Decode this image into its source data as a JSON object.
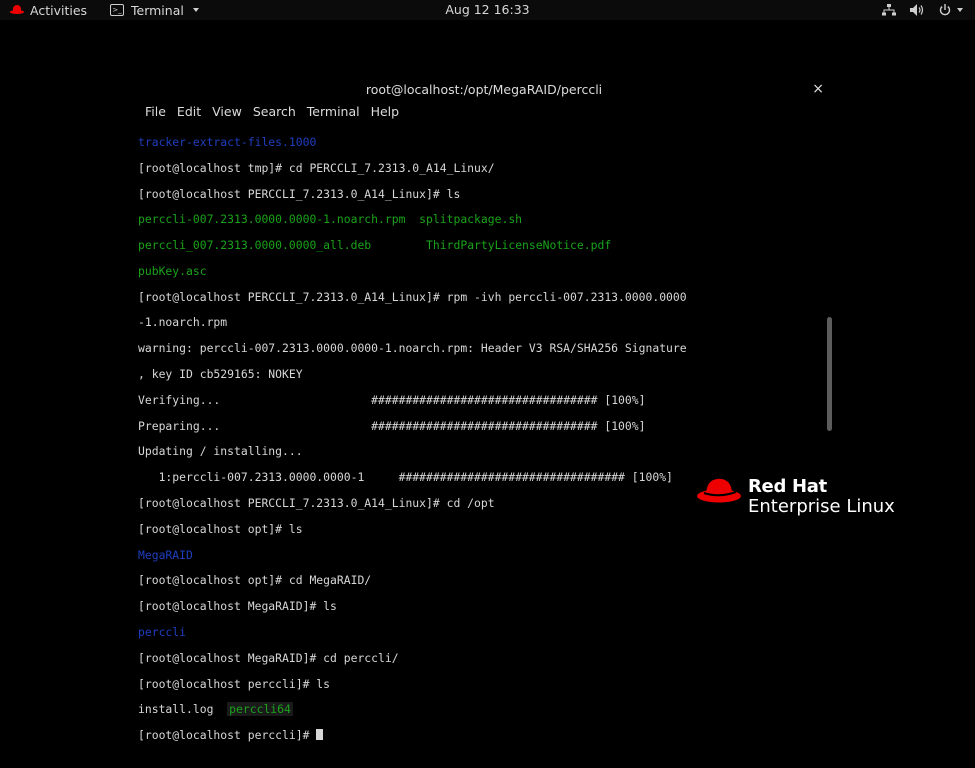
{
  "topbar": {
    "activities": "Activities",
    "app_name": "Terminal",
    "clock": "Aug 12 16:33"
  },
  "window": {
    "title": "root@localhost:/opt/MegaRAID/perccli",
    "close": "×",
    "menu": [
      "File",
      "Edit",
      "View",
      "Search",
      "Terminal",
      "Help"
    ]
  },
  "terminal": {
    "lines": [
      "tracker-extract-files.1000",
      "[root@localhost tmp]# cd PERCCLI_7.2313.0_A14_Linux/",
      "[root@localhost PERCCLI_7.2313.0_A14_Linux]# ls",
      "perccli-007.2313.0000.0000-1.noarch.rpm",
      "splitpackage.sh",
      "perccli_007.2313.0000.0000_all.deb",
      "ThirdPartyLicenseNotice.pdf",
      "pubKey.asc",
      "[root@localhost PERCCLI_7.2313.0_A14_Linux]# rpm -ivh perccli-007.2313.0000.0000",
      "-1.noarch.rpm",
      "warning: perccli-007.2313.0000.0000-1.noarch.rpm: Header V3 RSA/SHA256 Signature",
      ", key ID cb529165: NOKEY",
      "Verifying...",
      "################################# [100%]",
      "Preparing...",
      "################################# [100%]",
      "Updating / installing...",
      "   1:perccli-007.2313.0000.0000-1",
      "################################# [100%]",
      "[root@localhost PERCCLI_7.2313.0_A14_Linux]# cd /opt",
      "[root@localhost opt]# ls",
      "MegaRAID",
      "[root@localhost opt]# cd MegaRAID/",
      "[root@localhost MegaRAID]# ls",
      "perccli",
      "[root@localhost MegaRAID]# cd perccli/",
      "[root@localhost perccli]# ls",
      "install.log",
      "perccli64",
      "[root@localhost perccli]# "
    ]
  },
  "logo": {
    "line1": "Red Hat",
    "line2": "Enterprise Linux"
  },
  "colors": {
    "dir_blue": "#1f3ebf",
    "exec_green": "#1aa31a",
    "brand_red": "#ee0000"
  },
  "icons": [
    "redhat-icon",
    "terminal-icon",
    "network-icon",
    "volume-icon",
    "power-icon"
  ]
}
